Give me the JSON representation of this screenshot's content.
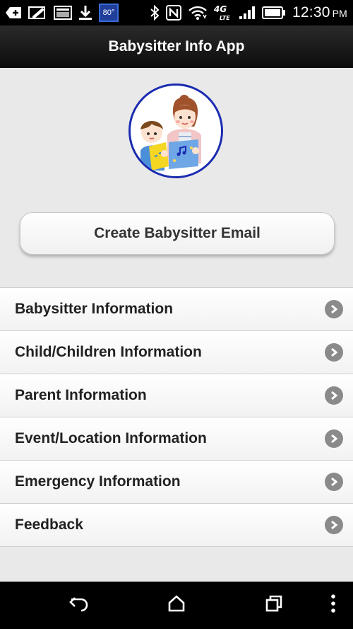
{
  "status_bar": {
    "temperature": "80°",
    "network": "4G LTE",
    "time": "12:30",
    "ampm": "PM",
    "icons": [
      "add-icon",
      "notes-icon",
      "image-icon",
      "download-icon",
      "temperature-badge",
      "bluetooth-icon",
      "nfc-icon",
      "wifi-icon",
      "lte-icon",
      "signal-icon",
      "battery-icon"
    ]
  },
  "action_bar": {
    "title": "Babysitter Info App"
  },
  "main": {
    "avatar_alt": "babysitter-illustration",
    "create_button": "Create Babysitter Email",
    "menu": [
      {
        "label": "Babysitter Information"
      },
      {
        "label": "Child/Children Information"
      },
      {
        "label": "Parent Information"
      },
      {
        "label": "Event/Location Information"
      },
      {
        "label": "Emergency Information"
      },
      {
        "label": "Feedback"
      }
    ]
  },
  "nav_bar": {
    "buttons": [
      "back-icon",
      "home-icon",
      "recents-icon",
      "overflow-menu-icon"
    ]
  },
  "colors": {
    "accent_ring": "#1a2bb0",
    "chevron": "#8a8a8a",
    "action_bar": "#1a1a1a"
  }
}
